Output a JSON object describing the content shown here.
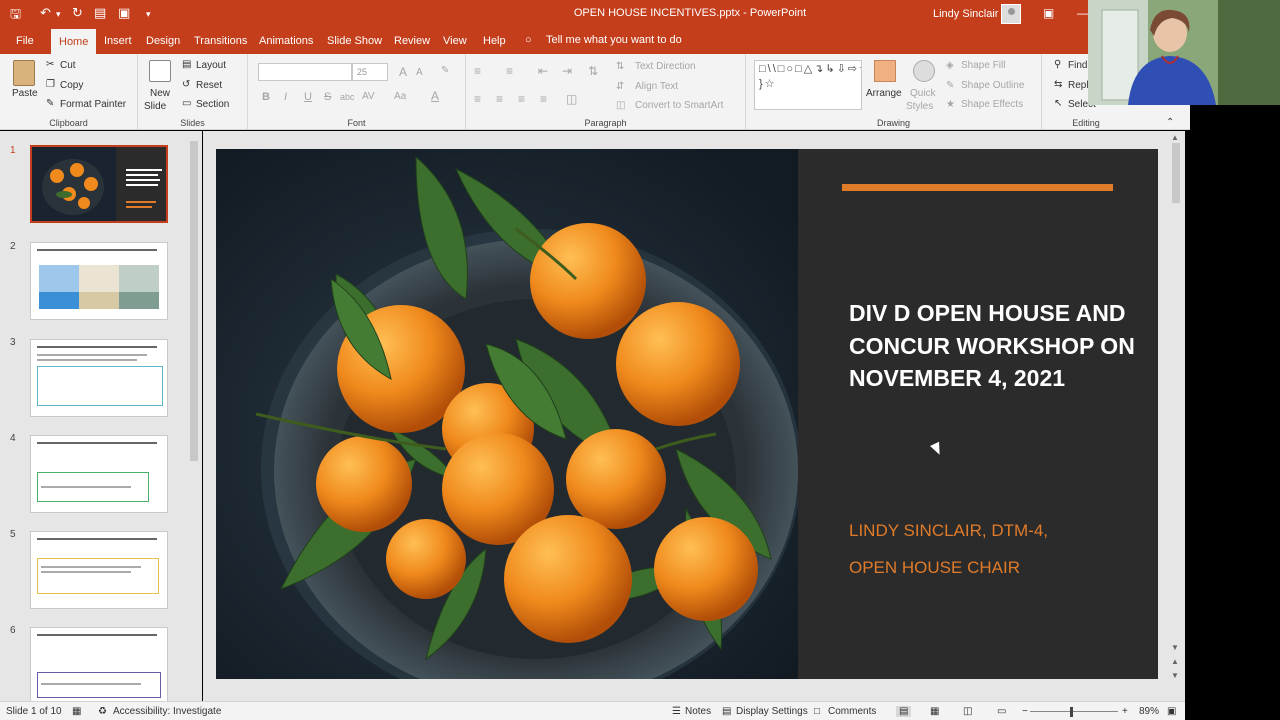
{
  "window": {
    "title": "OPEN HOUSE INCENTIVES.pptx  -  PowerPoint",
    "user_name": "Lindy Sinclair",
    "accent": "#c43e1c"
  },
  "quick_access": {
    "icons": [
      "save-icon",
      "undo-icon",
      "redo-icon",
      "present-icon",
      "new-slide-icon",
      "customize-icon"
    ]
  },
  "menu": {
    "tabs": [
      "File",
      "Home",
      "Insert",
      "Design",
      "Transitions",
      "Animations",
      "Slide Show",
      "Review",
      "View",
      "Help"
    ],
    "active_tab": "Home",
    "tell_me": "Tell me what you want to do"
  },
  "ribbon": {
    "clipboard": {
      "paste": "Paste",
      "cut": "Cut",
      "copy": "Copy",
      "format_painter": "Format Painter",
      "label": "Clipboard"
    },
    "slides": {
      "new_slide_1": "New",
      "new_slide_2": "Slide",
      "layout": "Layout",
      "reset": "Reset",
      "section": "Section",
      "label": "Slides"
    },
    "font": {
      "size": "25",
      "bold": "B",
      "italic": "I",
      "underline": "U",
      "strike": "S",
      "shadow": "abc",
      "spacing": "AV",
      "case": "Aa",
      "color": "A",
      "grow": "A",
      "shrink": "A",
      "label": "Font"
    },
    "paragraph": {
      "text_direction": "Text Direction",
      "align_text": "Align Text",
      "smartart": "Convert to SmartArt",
      "label": "Paragraph"
    },
    "drawing": {
      "arrange": "Arrange",
      "quick_styles_1": "Quick",
      "quick_styles_2": "Styles",
      "shape_fill": "Shape Fill",
      "shape_outline": "Shape Outline",
      "shape_effects": "Shape Effects",
      "label": "Drawing"
    },
    "editing": {
      "find": "Find",
      "replace": "Repl",
      "select": "Select",
      "label": "Editing"
    }
  },
  "thumbnails": {
    "numbers": [
      "1",
      "2",
      "3",
      "4",
      "5",
      "6"
    ],
    "active_index": 1
  },
  "slide": {
    "title": "DIV D OPEN HOUSE AND CONCUR WORKSHOP ON NOVEMBER 4, 2021",
    "subtitle_line1": "LINDY SINCLAIR, DTM-4,",
    "subtitle_line2": "OPEN HOUSE CHAIR",
    "accent_color": "#e07b29",
    "image": "bowl-of-tangerines-with-leaves"
  },
  "statusbar": {
    "slide_counter": "Slide 1 of 10",
    "accessibility": "Accessibility: Investigate",
    "notes": "Notes",
    "display_settings": "Display Settings",
    "comments": "Comments",
    "zoom": "89%",
    "zoom_minus": "−",
    "zoom_plus": "+"
  }
}
